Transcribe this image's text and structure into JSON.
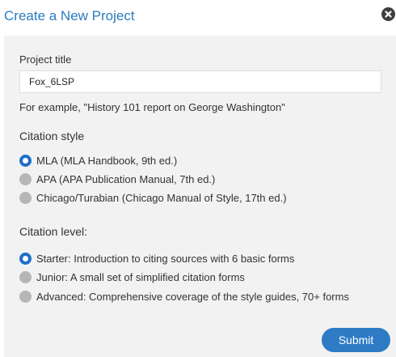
{
  "dialog": {
    "title": "Create a New Project",
    "close_icon": "close-circle-icon"
  },
  "project_title": {
    "label": "Project title",
    "value": "Fox_6LSP",
    "hint": "For example, \"History 101 report on George Washington\""
  },
  "citation_style": {
    "title": "Citation style",
    "options": [
      {
        "label": "MLA (MLA Handbook, 9th ed.)",
        "selected": true
      },
      {
        "label": "APA (APA Publication Manual, 7th ed.)",
        "selected": false
      },
      {
        "label": "Chicago/Turabian (Chicago Manual of Style, 17th ed.)",
        "selected": false
      }
    ]
  },
  "citation_level": {
    "title": "Citation level:",
    "options": [
      {
        "label": "Starter: Introduction to citing sources with 6 basic forms",
        "selected": true
      },
      {
        "label": "Junior: A small set of simplified citation forms",
        "selected": false
      },
      {
        "label": "Advanced: Comprehensive coverage of the style guides, 70+ forms",
        "selected": false
      }
    ]
  },
  "actions": {
    "submit_label": "Submit"
  },
  "colors": {
    "title": "#2b7bc0",
    "radio_selected": "#1f6fc9",
    "radio_unselected": "#b6b6b6",
    "submit_bg": "#2e7bc4",
    "panel_bg": "#f2f2f2"
  }
}
